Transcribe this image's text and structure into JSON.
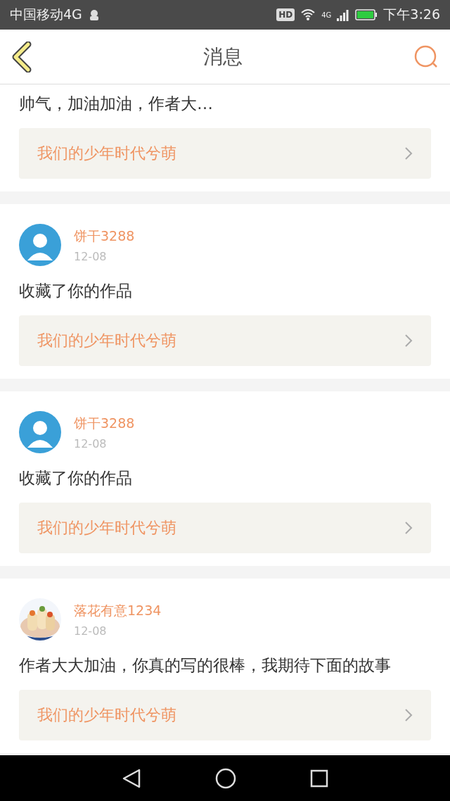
{
  "status_bar": {
    "carrier": "中国移动4G",
    "badge": "HD",
    "network": "4G",
    "time": "下午3:26"
  },
  "header": {
    "title": "消息"
  },
  "messages": [
    {
      "partial": true,
      "comment": "帅气，加油加油，作者大…",
      "work": "我们的少年时代兮萌"
    },
    {
      "partial": false,
      "avatar": {
        "kind": "figure"
      },
      "user": "饼干3288",
      "date": "12-08",
      "comment": "收藏了你的作品",
      "work": "我们的少年时代兮萌"
    },
    {
      "partial": false,
      "avatar": {
        "kind": "figure"
      },
      "user": "饼干3288",
      "date": "12-08",
      "comment": "收藏了你的作品",
      "work": "我们的少年时代兮萌"
    },
    {
      "partial": false,
      "user": "落花有意1234",
      "date": "12-08",
      "comment": "作者大大加油，你真的写的很棒，我期待下面的故事",
      "work": "我们的少年时代兮萌"
    }
  ]
}
